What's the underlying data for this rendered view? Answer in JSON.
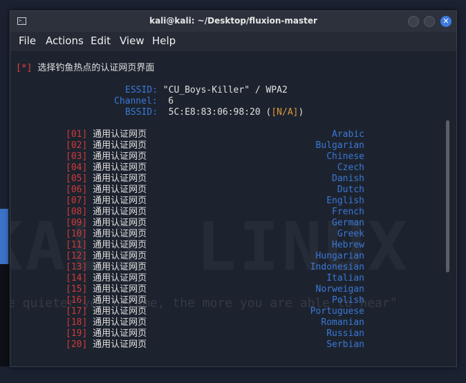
{
  "window": {
    "title": "kali@kali: ~/Desktop/fluxion-master",
    "close_glyph": "✕"
  },
  "menu": [
    "File",
    "Actions",
    "Edit",
    "View",
    "Help"
  ],
  "terminal": {
    "prompt_mark": "[*]",
    "heading": "选择钓鱼热点的认证网页界面",
    "essid_label": "ESSID:",
    "essid_value": "\"CU_Boys-Killer\" / WPA2",
    "channel_label": "Channel:",
    "channel_value": "6",
    "bssid_label": "BSSID:",
    "bssid_value": "5C:E8:83:06:98:20",
    "bssid_extra": "[N/A]",
    "portals": [
      {
        "index": "01",
        "name": "通用认证网页",
        "language": "Arabic"
      },
      {
        "index": "02",
        "name": "通用认证网页",
        "language": "Bulgarian"
      },
      {
        "index": "03",
        "name": "通用认证网页",
        "language": "Chinese"
      },
      {
        "index": "04",
        "name": "通用认证网页",
        "language": "Czech"
      },
      {
        "index": "05",
        "name": "通用认证网页",
        "language": "Danish"
      },
      {
        "index": "06",
        "name": "通用认证网页",
        "language": "Dutch"
      },
      {
        "index": "07",
        "name": "通用认证网页",
        "language": "English"
      },
      {
        "index": "08",
        "name": "通用认证网页",
        "language": "French"
      },
      {
        "index": "09",
        "name": "通用认证网页",
        "language": "German"
      },
      {
        "index": "10",
        "name": "通用认证网页",
        "language": "Greek"
      },
      {
        "index": "11",
        "name": "通用认证网页",
        "language": "Hebrew"
      },
      {
        "index": "12",
        "name": "通用认证网页",
        "language": "Hungarian"
      },
      {
        "index": "13",
        "name": "通用认证网页",
        "language": "Indonesian"
      },
      {
        "index": "14",
        "name": "通用认证网页",
        "language": "Italian"
      },
      {
        "index": "15",
        "name": "通用认证网页",
        "language": "Norweigan"
      },
      {
        "index": "16",
        "name": "通用认证网页",
        "language": "Polish"
      },
      {
        "index": "17",
        "name": "通用认证网页",
        "language": "Portuguese"
      },
      {
        "index": "18",
        "name": "通用认证网页",
        "language": "Romanian"
      },
      {
        "index": "19",
        "name": "通用认证网页",
        "language": "Russian"
      },
      {
        "index": "20",
        "name": "通用认证网页",
        "language": "Serbian"
      }
    ]
  },
  "wallpaper": {
    "logo_text": "KALI LINUX",
    "quote": "e quieter you become, the more you are able to hear\""
  },
  "colors": {
    "accent_blue": "#3a78d8",
    "index_red": "#d03a3a",
    "warning_orange": "#e09a3a"
  }
}
